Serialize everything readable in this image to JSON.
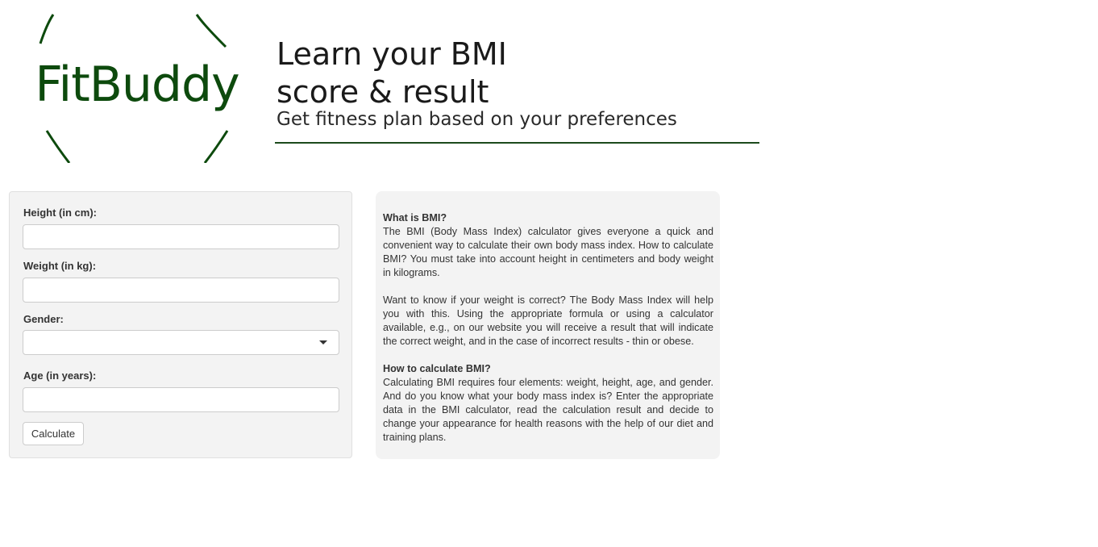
{
  "brand": {
    "logo_text": "FitBuddy",
    "color": "#0d4a0d"
  },
  "hero": {
    "title_line1": "Learn your BMI",
    "title_line2": "score & result",
    "subtitle": "Get fitness plan based on your preferences"
  },
  "form": {
    "height_label": "Height (in cm):",
    "height_value": "",
    "weight_label": "Weight (in kg):",
    "weight_value": "",
    "gender_label": "Gender:",
    "gender_selected": "",
    "age_label": "Age (in years):",
    "age_value": "",
    "calculate_label": "Calculate"
  },
  "info": {
    "heading1": "What is BMI?",
    "para1": "The BMI (Body Mass Index) calculator gives everyone a quick and convenient way to calculate their own body mass index. How to calculate BMI? You must take into account height in centimeters and body weight in kilograms.",
    "para2": "Want to know if your weight is correct? The Body Mass Index will help you with this. Using the appropriate formula or using a calculator available, e.g., on our website you will receive a result that will indicate the correct weight, and in the case of incorrect results - thin or obese.",
    "heading2": "How to calculate BMI?",
    "para3": "Calculating BMI requires four elements: weight, height, age, and gender. And do you know what your body mass index is? Enter the appropriate data in the BMI calculator, read the calculation result and decide to change your appearance for health reasons with the help of our diet and training plans."
  },
  "icons": {
    "select_caret": "chevron-down-icon"
  }
}
